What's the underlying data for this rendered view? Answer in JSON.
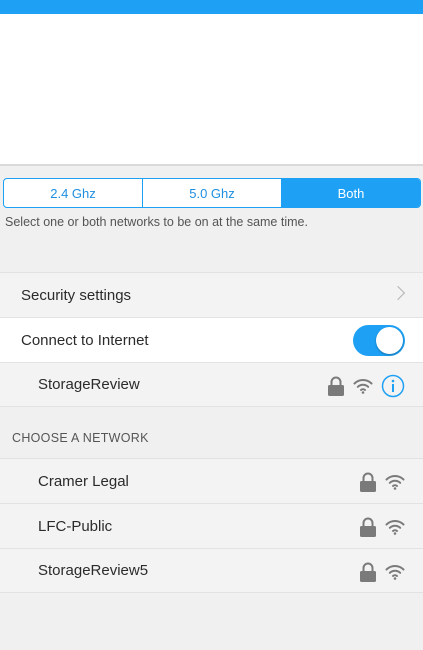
{
  "bands": {
    "segmented": {
      "options": [
        "2.4 Ghz",
        "5.0 Ghz",
        "Both"
      ],
      "selected": "Both"
    },
    "hint": "Select one or both networks to be on at the same time."
  },
  "settings": {
    "security_label": "Security settings",
    "internet_label": "Connect to Internet",
    "internet_on": true,
    "current_network": "StorageReview"
  },
  "choose_network": {
    "header": "CHOOSE A NETWORK",
    "networks": [
      {
        "name": "Cramer Legal",
        "secured": true
      },
      {
        "name": "LFC-Public",
        "secured": true
      },
      {
        "name": "StorageReview5",
        "secured": true
      }
    ]
  },
  "colors": {
    "accent": "#1ea1f5",
    "icon_gray": "#7a7a7a"
  },
  "icons": {
    "lock": "lock-icon",
    "wifi": "wifi-icon",
    "info": "info-icon",
    "chevron": "chevron-right-icon"
  }
}
